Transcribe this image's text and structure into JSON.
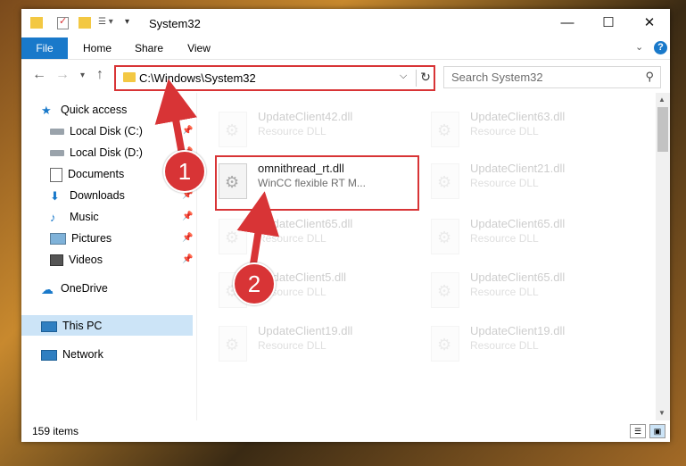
{
  "window": {
    "title": "System32"
  },
  "ribbon": {
    "tabs": [
      "File",
      "Home",
      "Share",
      "View"
    ],
    "help": "?"
  },
  "navigation": {
    "address": "C:\\Windows\\System32",
    "search_placeholder": "Search System32"
  },
  "sidebar": {
    "items": [
      {
        "label": "Quick access",
        "icon": "star-icon"
      },
      {
        "label": "Local Disk (C:)",
        "icon": "drive-icon",
        "pinned": true
      },
      {
        "label": "Local Disk (D:)",
        "icon": "drive-icon",
        "pinned": true
      },
      {
        "label": "Documents",
        "icon": "documents-icon",
        "pinned": true
      },
      {
        "label": "Downloads",
        "icon": "downloads-icon",
        "pinned": true
      },
      {
        "label": "Music",
        "icon": "music-icon",
        "pinned": true
      },
      {
        "label": "Pictures",
        "icon": "pictures-icon",
        "pinned": true
      },
      {
        "label": "Videos",
        "icon": "videos-icon",
        "pinned": true
      },
      {
        "label": "OneDrive",
        "icon": "cloud-icon"
      },
      {
        "label": "This PC",
        "icon": "computer-icon",
        "selected": true
      },
      {
        "label": "Network",
        "icon": "network-icon"
      }
    ]
  },
  "files": [
    {
      "name": "UpdateClient42.dll",
      "type": "Resource DLL",
      "faded": true
    },
    {
      "name": "UpdateClient63.dll",
      "type": "Resource DLL",
      "faded": true
    },
    {
      "name": "omnithread_rt.dll",
      "type": "WinCC flexible RT M...",
      "faded": false,
      "highlighted": true
    },
    {
      "name": "UpdateClient21.dll",
      "type": "Resource DLL",
      "faded": true
    },
    {
      "name": "UpdateClient65.dll",
      "type": "Resource DLL",
      "faded": true
    },
    {
      "name": "UpdateClient65.dll",
      "type": "Resource DLL",
      "faded": true
    },
    {
      "name": "UpdateClient5.dll",
      "type": "Resource DLL",
      "faded": true
    },
    {
      "name": "UpdateClient65.dll",
      "type": "Resource DLL",
      "faded": true
    },
    {
      "name": "UpdateClient19.dll",
      "type": "Resource DLL",
      "faded": true
    },
    {
      "name": "UpdateClient19.dll",
      "type": "Resource DLL",
      "faded": true
    }
  ],
  "status": {
    "count": "159 items"
  },
  "annotations": {
    "badge1": "1",
    "badge2": "2",
    "color": "#d83436"
  },
  "colors": {
    "accent": "#1979ca",
    "selection": "#cce4f7",
    "highlight": "#d83436"
  }
}
